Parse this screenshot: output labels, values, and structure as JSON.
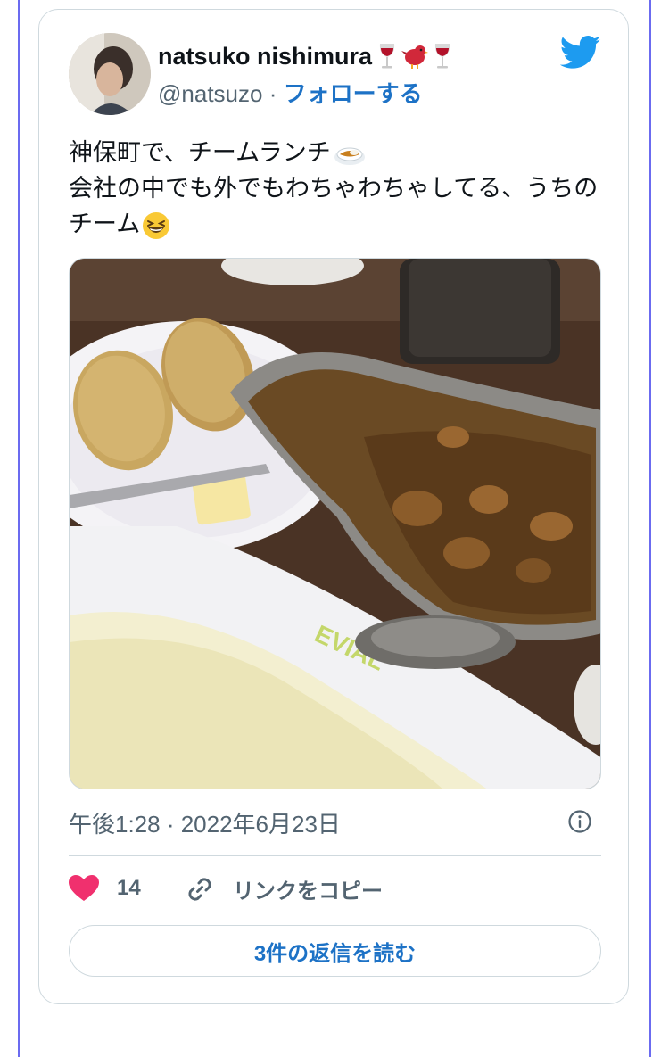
{
  "tweet": {
    "author": {
      "display_name": "natsuko nishimura",
      "name_emojis": [
        "wine-glass",
        "bird",
        "wine-glass"
      ],
      "handle": "@natsuzo",
      "separator": "·",
      "follow_label": "フォローする"
    },
    "text_lines": [
      "神保町で、チームランチ",
      "会社の中でも外でもわちゃわちゃしてる、うちの",
      "チーム"
    ],
    "text_emojis": [
      "curry-rice",
      "grinning-squinting-face"
    ],
    "media": {
      "description_icon": "photo-curry-lunch"
    },
    "timestamp": "午後1:28 · 2022年6月23日",
    "likes": {
      "count": "14",
      "icon": "heart-icon"
    },
    "copy_link": {
      "label": "リンクをコピー",
      "icon": "link-icon"
    },
    "replies_button_label": "3件の返信を読む"
  },
  "colors": {
    "accent": "#1d72c6",
    "twitter_blue": "#1d9bf0",
    "like_pink": "#f0306e",
    "muted_text": "#536471",
    "border": "#cfd9de",
    "page_rule": "#6b6bf0"
  }
}
